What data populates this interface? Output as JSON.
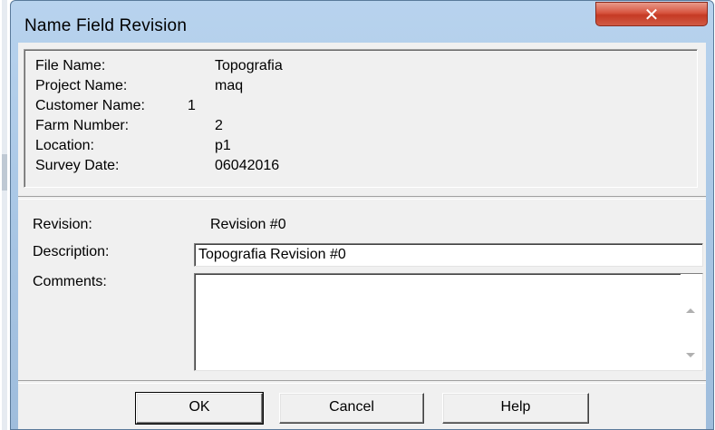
{
  "window": {
    "title": "Name Field Revision",
    "close_icon": "close-icon"
  },
  "info": [
    {
      "label": "File Name:",
      "value": "Topografia"
    },
    {
      "label": "Project Name:",
      "value": "maq"
    },
    {
      "label": "Customer Name:",
      "value": "1"
    },
    {
      "label": "Farm Number:",
      "value": "2"
    },
    {
      "label": "Location:",
      "value": "p1"
    },
    {
      "label": "Survey Date:",
      "value": "06042016"
    }
  ],
  "form": {
    "revision_label": "Revision:",
    "revision_value": "Revision #0",
    "description_label": "Description:",
    "description_value": "Topografia Revision #0",
    "comments_label": "Comments:",
    "comments_value": ""
  },
  "buttons": {
    "ok": "OK",
    "cancel": "Cancel",
    "help": "Help"
  }
}
